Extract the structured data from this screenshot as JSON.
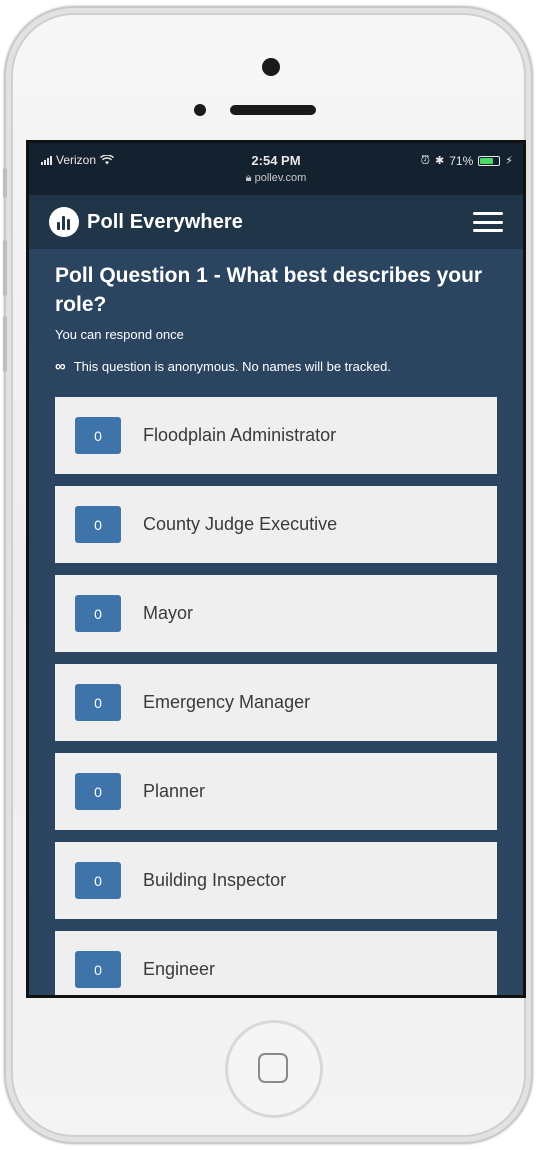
{
  "status_bar": {
    "carrier": "Verizon",
    "time": "2:54 PM",
    "url": "pollev.com",
    "battery": "71%",
    "battery_level": 0.71
  },
  "app": {
    "brand": "Poll Everywhere"
  },
  "poll": {
    "title": "Poll Question 1 - What best describes your role?",
    "respond_note": "You can respond once",
    "anonymous_note": "This question is anonymous. No names will be tracked.",
    "options": [
      {
        "count": "0",
        "label": "Floodplain Administrator"
      },
      {
        "count": "0",
        "label": "County Judge Executive"
      },
      {
        "count": "0",
        "label": "Mayor"
      },
      {
        "count": "0",
        "label": "Emergency Manager"
      },
      {
        "count": "0",
        "label": "Planner"
      },
      {
        "count": "0",
        "label": "Building Inspector"
      },
      {
        "count": "0",
        "label": "Engineer"
      }
    ]
  },
  "colors": {
    "background": "#2b4560",
    "appbar": "#203548",
    "count_badge": "#3f74aa",
    "option_bg": "#efefef"
  }
}
